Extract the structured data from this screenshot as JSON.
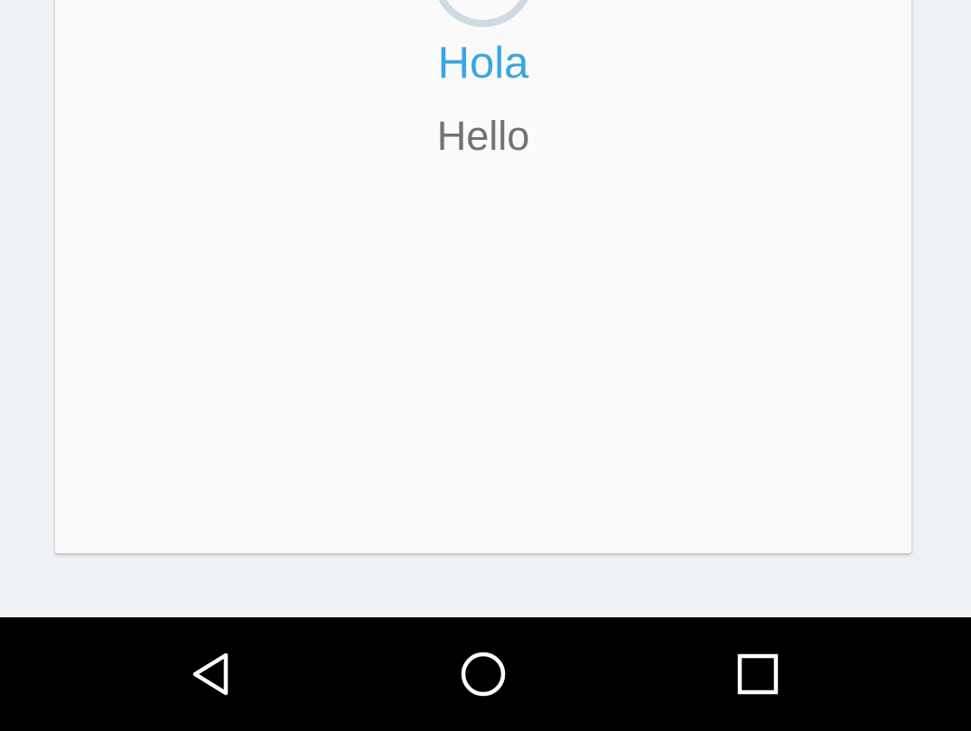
{
  "card": {
    "title": "Hola",
    "subtitle": "Hello"
  },
  "colors": {
    "title": "#3aa5e3",
    "subtitle": "#727272",
    "background": "#eff2f5",
    "card": "#fafafa",
    "navbar": "#000000",
    "nav_icon": "#ffffff"
  },
  "navbar": {
    "buttons": [
      {
        "icon": "back-icon"
      },
      {
        "icon": "home-icon"
      },
      {
        "icon": "recents-icon"
      }
    ]
  }
}
